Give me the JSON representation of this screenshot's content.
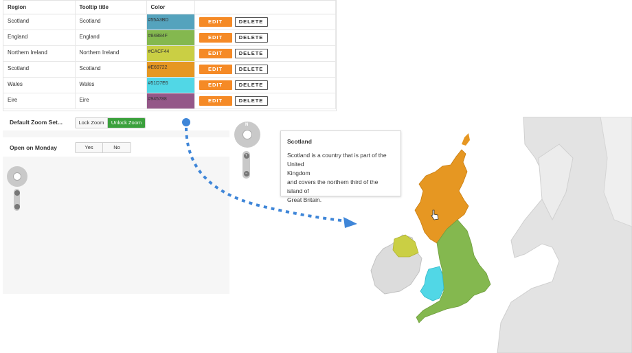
{
  "table": {
    "headers": {
      "region": "Region",
      "tooltip": "Tooltip title",
      "color": "Color"
    },
    "rows": [
      {
        "region": "Scotland",
        "tooltip": "Scotland",
        "color": "#55A3BD"
      },
      {
        "region": "England",
        "tooltip": "England",
        "color": "#84B84F"
      },
      {
        "region": "Northern Ireland",
        "tooltip": "Northern Ireland",
        "color": "#CACF44"
      },
      {
        "region": "Scotland",
        "tooltip": "Scotland",
        "color": "#E69722"
      },
      {
        "region": "Wales",
        "tooltip": "Wales",
        "color": "#51D7E6"
      },
      {
        "region": "Eire",
        "tooltip": "Eire",
        "color": "#945788"
      }
    ],
    "edit_label": "EDIT",
    "delete_label": "DELETE"
  },
  "settings": {
    "zoom_label": "Default Zoom Set...",
    "zoom_options": [
      "Lock Zoom",
      "Unlock Zoom"
    ],
    "zoom_selected": "Unlock Zoom",
    "monday_label": "Open on Monday",
    "monday_options": [
      "Yes",
      "No"
    ]
  },
  "nav": {
    "north": "N",
    "zoom_in": "+",
    "zoom_out": "−"
  },
  "tooltip": {
    "title": "Scotland",
    "lines": [
      "Scotland is a country that is part of the United",
      "Kingdom",
      "and covers the northern third of the island of",
      "Great Britain."
    ]
  },
  "colors": {
    "accent_orange": "#f58a26",
    "toggle_active": "#3aa03c",
    "arrow_blue": "#3f86d8",
    "scotland": "#E69722",
    "england": "#84B84F",
    "northern_ireland": "#CACF44",
    "wales": "#51D7E6",
    "land_grey": "#d9d9d9"
  }
}
